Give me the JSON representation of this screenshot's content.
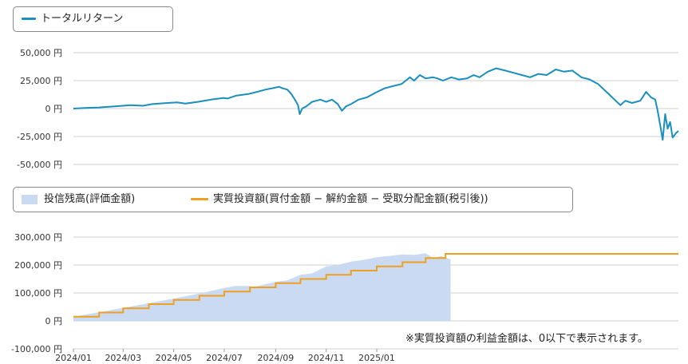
{
  "legend_top": {
    "label": "トータルリターン",
    "color": "#1a8fbf"
  },
  "legend_bottom": {
    "balance_label": "投信残高(評価金額)",
    "balance_color": "#c9daf2",
    "invested_label": "実質投資額(買付金額 − 解約金額 − 受取分配金額(税引後))",
    "invested_color": "#f0a020"
  },
  "note": "※実質投資額の利益金額は、0以下で表示されます。",
  "chart_data": [
    {
      "type": "line",
      "name": "total-return",
      "series": [
        {
          "name": "トータルリターン"
        }
      ],
      "y_ticks": [
        "50,000 円",
        "25,000 円",
        "0 円",
        "-25,000 円",
        "-50,000 円"
      ],
      "ylim": [
        -50000,
        50000
      ],
      "x_range": [
        "2024-01-01",
        "2025-03-31"
      ],
      "grid": true,
      "points": [
        [
          "2024-01-01",
          0
        ],
        [
          "2024-01-15",
          500
        ],
        [
          "2024-02-01",
          1000
        ],
        [
          "2024-02-20",
          2000
        ],
        [
          "2024-03-10",
          3000
        ],
        [
          "2024-03-25",
          2500
        ],
        [
          "2024-04-05",
          4000
        ],
        [
          "2024-04-20",
          4800
        ],
        [
          "2024-05-05",
          5500
        ],
        [
          "2024-05-15",
          4500
        ],
        [
          "2024-05-30",
          6000
        ],
        [
          "2024-06-15",
          8000
        ],
        [
          "2024-06-30",
          9500
        ],
        [
          "2024-07-05",
          9000
        ],
        [
          "2024-07-15",
          11500
        ],
        [
          "2024-07-30",
          13000
        ],
        [
          "2024-08-10",
          15000
        ],
        [
          "2024-08-20",
          17000
        ],
        [
          "2024-08-30",
          18500
        ],
        [
          "2024-09-05",
          19500
        ],
        [
          "2024-09-10",
          18000
        ],
        [
          "2024-09-15",
          17000
        ],
        [
          "2024-09-20",
          13000
        ],
        [
          "2024-09-25",
          7000
        ],
        [
          "2024-09-28",
          3000
        ],
        [
          "2024-09-30",
          -5000
        ],
        [
          "2024-10-03",
          0
        ],
        [
          "2024-10-08",
          2000
        ],
        [
          "2024-10-15",
          6000
        ],
        [
          "2024-10-25",
          8000
        ],
        [
          "2024-11-01",
          6000
        ],
        [
          "2024-11-08",
          8000
        ],
        [
          "2024-11-15",
          4000
        ],
        [
          "2024-11-20",
          -2000
        ],
        [
          "2024-11-25",
          2000
        ],
        [
          "2024-12-01",
          4000
        ],
        [
          "2024-12-10",
          8000
        ],
        [
          "2024-12-20",
          10000
        ],
        [
          "2024-12-30",
          14000
        ],
        [
          "2025-01-10",
          18000
        ],
        [
          "2025-01-20",
          20000
        ],
        [
          "2025-01-31",
          22000
        ],
        [
          "2025-02-05",
          25000
        ],
        [
          "2025-02-10",
          28000
        ],
        [
          "2025-02-15",
          25000
        ],
        [
          "2025-02-22",
          30000
        ],
        [
          "2025-03-01",
          27000
        ],
        [
          "2025-03-10",
          28000
        ],
        [
          "2025-03-15",
          27000
        ],
        [
          "2025-03-22",
          25000
        ],
        [
          "2025-04-01",
          28000
        ],
        [
          "2025-04-10",
          26000
        ],
        [
          "2025-04-20",
          27000
        ],
        [
          "2025-04-28",
          30000
        ],
        [
          "2025-05-05",
          28000
        ],
        [
          "2025-05-15",
          33000
        ],
        [
          "2025-05-25",
          36000
        ],
        [
          "2025-06-05",
          34000
        ],
        [
          "2025-06-15",
          32000
        ],
        [
          "2025-06-25",
          30000
        ],
        [
          "2025-07-05",
          28000
        ],
        [
          "2025-07-15",
          31000
        ],
        [
          "2025-07-25",
          30000
        ],
        [
          "2025-08-05",
          35000
        ],
        [
          "2025-08-15",
          33000
        ],
        [
          "2025-08-25",
          34000
        ],
        [
          "2025-09-05",
          28000
        ],
        [
          "2025-09-15",
          26000
        ],
        [
          "2025-09-25",
          22000
        ],
        [
          "2025-10-05",
          15000
        ],
        [
          "2025-10-15",
          8000
        ],
        [
          "2025-10-22",
          3000
        ],
        [
          "2025-10-28",
          7000
        ],
        [
          "2025-11-05",
          5000
        ],
        [
          "2025-11-15",
          7000
        ],
        [
          "2025-11-22",
          15000
        ],
        [
          "2025-11-28",
          10000
        ],
        [
          "2025-12-03",
          8000
        ],
        [
          "2025-12-06",
          -2000
        ],
        [
          "2025-12-09",
          -15000
        ],
        [
          "2025-12-12",
          -28000
        ],
        [
          "2025-12-15",
          -5000
        ],
        [
          "2025-12-18",
          -18000
        ],
        [
          "2025-12-21",
          -12000
        ],
        [
          "2025-12-24",
          -26000
        ],
        [
          "2025-12-28",
          -22000
        ],
        [
          "2025-12-31",
          -20000
        ]
      ]
    },
    {
      "type": "area",
      "name": "balance-and-invested",
      "y_ticks": [
        "300,000 円",
        "200,000 円",
        "100,000 円",
        "0 円",
        "-100,000 円"
      ],
      "ylim": [
        -100000,
        300000
      ],
      "x_ticks": [
        "2024/01",
        "2024/03",
        "2024/05",
        "2024/07",
        "2024/09",
        "2024/11",
        "2025/01"
      ],
      "grid": true,
      "series": [
        {
          "name": "投信残高(評価金額)"
        },
        {
          "name": "実質投資額(買付金額 − 解約金額 − 受取分配金額(税引後))"
        }
      ],
      "invested_steps": [
        [
          "2024-01",
          15000
        ],
        [
          "2024-02",
          30000
        ],
        [
          "2024-03",
          45000
        ],
        [
          "2024-04",
          60000
        ],
        [
          "2024-05",
          75000
        ],
        [
          "2024-06",
          90000
        ],
        [
          "2024-07",
          105000
        ],
        [
          "2024-08",
          120000
        ],
        [
          "2024-09",
          135000
        ],
        [
          "2024-10",
          150000
        ],
        [
          "2024-11",
          165000
        ],
        [
          "2024-12",
          180000
        ],
        [
          "2025-01",
          195000
        ],
        [
          "2025-02",
          210000
        ],
        [
          "2025-03",
          225000
        ],
        [
          "2025-03-25",
          240000
        ]
      ],
      "balance_points": [
        [
          "2024-01-01",
          15000
        ],
        [
          "2024-02-01",
          31000
        ],
        [
          "2024-03-01",
          47000
        ],
        [
          "2024-04-01",
          63000
        ],
        [
          "2024-05-01",
          80000
        ],
        [
          "2024-06-01",
          98000
        ],
        [
          "2024-07-01",
          118000
        ],
        [
          "2024-07-15",
          125000
        ],
        [
          "2024-08-01",
          125000
        ],
        [
          "2024-08-05",
          122000
        ],
        [
          "2024-08-15",
          128000
        ],
        [
          "2024-09-01",
          140000
        ],
        [
          "2024-09-15",
          145000
        ],
        [
          "2024-10-01",
          165000
        ],
        [
          "2024-10-15",
          170000
        ],
        [
          "2024-11-01",
          195000
        ],
        [
          "2024-11-15",
          200000
        ],
        [
          "2024-12-01",
          212000
        ],
        [
          "2024-12-15",
          218000
        ],
        [
          "2025-01-01",
          228000
        ],
        [
          "2025-01-15",
          232000
        ],
        [
          "2025-02-01",
          238000
        ],
        [
          "2025-02-15",
          236000
        ],
        [
          "2025-03-01",
          242000
        ],
        [
          "2025-03-10",
          225000
        ],
        [
          "2025-03-20",
          232000
        ],
        [
          "2025-03-31",
          220000
        ]
      ],
      "note": "※実質投資額の利益金額は、0以下で表示されます。"
    }
  ]
}
